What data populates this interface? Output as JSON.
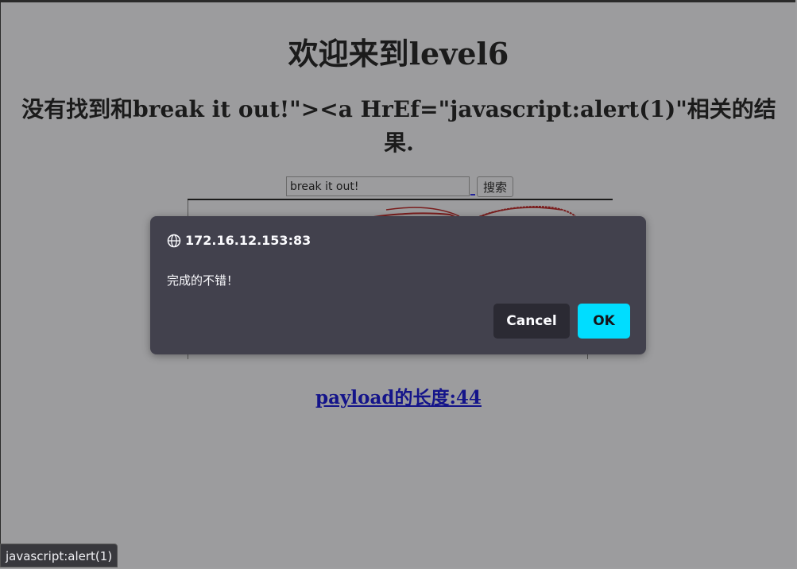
{
  "page": {
    "title": "欢迎来到level6",
    "result_text": "没有找到和break it out!\"><a HrEf=\"javascript:alert(1)\"相关的结果.",
    "search": {
      "value": "break it out!",
      "button_label": "搜索"
    },
    "payload_link": "payload的长度:44"
  },
  "dialog": {
    "origin": "172.16.12.153:83",
    "message": "完成的不错！",
    "cancel_label": "Cancel",
    "ok_label": "OK",
    "icon": "globe-icon",
    "accent_color": "#00ddff"
  },
  "statusbar": {
    "text": "javascript:alert(1)"
  }
}
